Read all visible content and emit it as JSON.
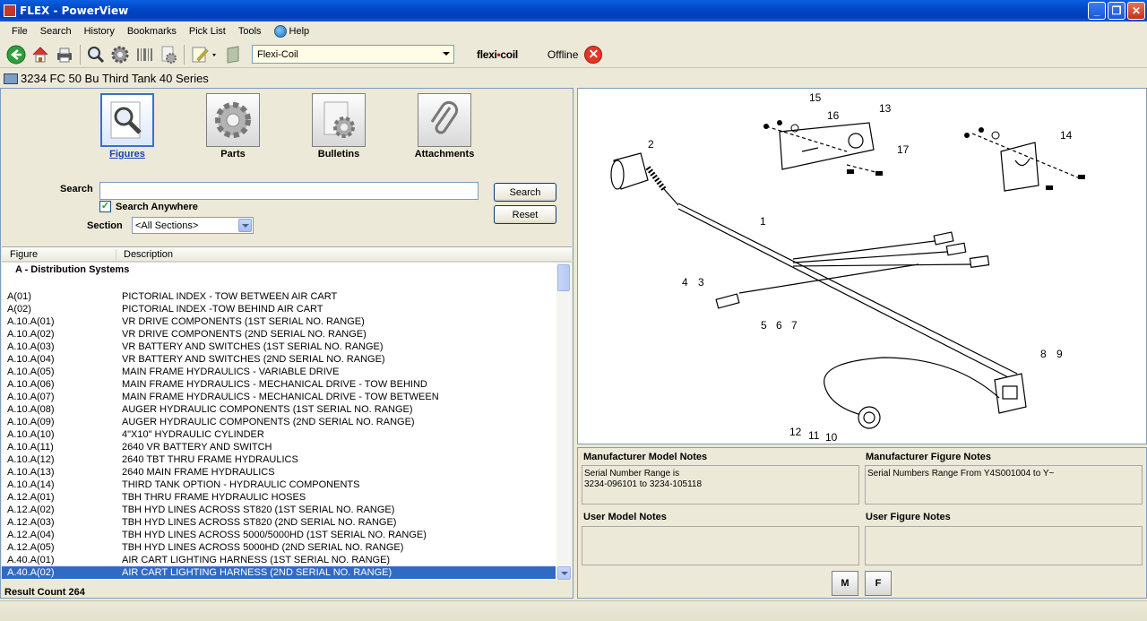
{
  "window": {
    "title": "FLEX - PowerView"
  },
  "menu": [
    "File",
    "Search",
    "History",
    "Bookmarks",
    "Pick List",
    "Tools",
    "Help"
  ],
  "toolbar": {
    "brand_combo": "Flexi-Coil",
    "brand_logo_left": "flexi",
    "brand_logo_x": "•",
    "brand_logo_right": "coil",
    "status": "Offline"
  },
  "breadcrumb": "3234 FC 50 Bu Third Tank 40 Series",
  "nav": {
    "figures": "Figures",
    "parts": "Parts",
    "bulletins": "Bulletins",
    "attachments": "Attachments"
  },
  "search": {
    "label": "Search",
    "value": "",
    "anywhere_label": "Search Anywhere",
    "anywhere_checked": true,
    "section_label": "Section",
    "section_value": "<All Sections>",
    "search_button": "Search",
    "reset_button": "Reset"
  },
  "list": {
    "col_figure": "Figure",
    "col_description": "Description",
    "group": "A - Distribution Systems",
    "rows": [
      {
        "fig": "A(01)",
        "desc": "PICTORIAL INDEX - TOW BETWEEN AIR CART"
      },
      {
        "fig": "A(02)",
        "desc": "PICTORIAL INDEX -TOW BEHIND AIR CART"
      },
      {
        "fig": "A.10.A(01)",
        "desc": "VR DRIVE COMPONENTS (1ST SERIAL NO. RANGE)"
      },
      {
        "fig": "A.10.A(02)",
        "desc": "VR DRIVE COMPONENTS (2ND SERIAL NO. RANGE)"
      },
      {
        "fig": "A.10.A(03)",
        "desc": "VR BATTERY AND SWITCHES (1ST SERIAL NO. RANGE)"
      },
      {
        "fig": "A.10.A(04)",
        "desc": "VR BATTERY AND SWITCHES (2ND SERIAL NO. RANGE)"
      },
      {
        "fig": "A.10.A(05)",
        "desc": "MAIN FRAME HYDRAULICS - VARIABLE DRIVE"
      },
      {
        "fig": "A.10.A(06)",
        "desc": "MAIN FRAME HYDRAULICS - MECHANICAL DRIVE - TOW BEHIND"
      },
      {
        "fig": "A.10.A(07)",
        "desc": "MAIN FRAME HYDRAULICS - MECHANICAL DRIVE - TOW BETWEEN"
      },
      {
        "fig": "A.10.A(08)",
        "desc": "AUGER HYDRAULIC COMPONENTS (1ST SERIAL NO. RANGE)"
      },
      {
        "fig": "A.10.A(09)",
        "desc": "AUGER HYDRAULIC COMPONENTS (2ND SERIAL NO. RANGE)"
      },
      {
        "fig": "A.10.A(10)",
        "desc": "4\"X10\" HYDRAULIC CYLINDER"
      },
      {
        "fig": "A.10.A(11)",
        "desc": "2640 VR BATTERY AND SWITCH"
      },
      {
        "fig": "A.10.A(12)",
        "desc": "2640 TBT THRU FRAME HYDRAULICS"
      },
      {
        "fig": "A.10.A(13)",
        "desc": "2640 MAIN FRAME HYDRAULICS"
      },
      {
        "fig": "A.10.A(14)",
        "desc": "THIRD TANK OPTION - HYDRAULIC COMPONENTS"
      },
      {
        "fig": "A.12.A(01)",
        "desc": "TBH THRU FRAME HYDRAULIC HOSES"
      },
      {
        "fig": "A.12.A(02)",
        "desc": "TBH HYD LINES ACROSS ST820 (1ST SERIAL NO. RANGE)"
      },
      {
        "fig": "A.12.A(03)",
        "desc": "TBH HYD LINES ACROSS ST820 (2ND SERIAL NO. RANGE)"
      },
      {
        "fig": "A.12.A(04)",
        "desc": "TBH HYD LINES ACROSS 5000/5000HD (1ST SERIAL NO. RANGE)"
      },
      {
        "fig": "A.12.A(05)",
        "desc": "TBH HYD LINES ACROSS 5000HD (2ND SERIAL NO. RANGE)"
      },
      {
        "fig": "A.40.A(01)",
        "desc": "AIR CART LIGHTING HARNESS (1ST SERIAL NO. RANGE)"
      },
      {
        "fig": "A.40.A(02)",
        "desc": "AIR CART LIGHTING HARNESS (2ND SERIAL NO. RANGE)",
        "selected": true
      }
    ],
    "result_count": "Result Count 264"
  },
  "figure": {
    "callouts": [
      "1",
      "2",
      "3",
      "4",
      "5",
      "6",
      "7",
      "8",
      "9",
      "10",
      "11",
      "12",
      "13",
      "14",
      "15",
      "16",
      "17"
    ]
  },
  "notes": {
    "mfr_model_label": "Manufacturer Model Notes",
    "mfr_model_line1": "Serial Number Range is",
    "mfr_model_line2": "3234-096101 to 3234-105118",
    "mfr_figure_label": "Manufacturer Figure Notes",
    "mfr_figure_text": "Serial Numbers Range From Y4S001004 to Y~",
    "user_model_label": "User Model Notes",
    "user_figure_label": "User Figure Notes",
    "btn_m": "M",
    "btn_f": "F"
  },
  "colors": {
    "titlebar": "#0148c6",
    "selection": "#316ac5",
    "chrome": "#ece9d8"
  }
}
